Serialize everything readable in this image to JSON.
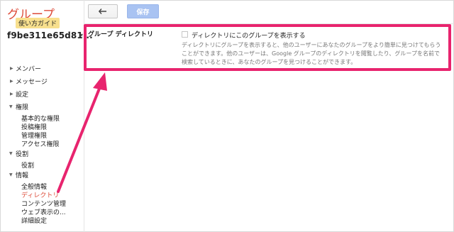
{
  "app": {
    "logo_title": "グループ",
    "logo_subtitle": "使い方ガイド",
    "group_id": "f9be311e65d81...",
    "group_caret": "▾"
  },
  "toolbar": {
    "back_label": "",
    "save_label": "保存"
  },
  "sidebar": {
    "sections": [
      {
        "label": "メンバー",
        "expanded": false
      },
      {
        "label": "メッセージ",
        "expanded": false
      },
      {
        "label": "設定",
        "expanded": false
      },
      {
        "label": "権限",
        "expanded": true,
        "items": [
          "基本的な権限",
          "投稿権限",
          "管理権限",
          "アクセス権限"
        ]
      },
      {
        "label": "役割",
        "expanded": true,
        "items": [
          "役割"
        ]
      },
      {
        "label": "情報",
        "expanded": true,
        "items": [
          "全般情報",
          "ディレクトリ",
          "コンテンツ管理",
          "ウェブ表示の...",
          "詳細設定"
        ]
      }
    ],
    "active_item": "ディレクトリ"
  },
  "main": {
    "setting_label": "グループ ディレクトリ",
    "checkbox_label": "ディレクトリにこのグループを表示する",
    "checkbox_checked": false,
    "description_lines": [
      "ディレクトリにグループを表示すると、他のユーザーにあなたのグループをより簡単に見つけてもらう",
      "ことができます。他のユーザーは、Google グループのディレクトリを閲覧したり、グループを名前で",
      "検索しているときに、あなたのグループを見つけることができます。"
    ]
  },
  "colors": {
    "brand_red": "#dd4b39",
    "annotation_pink": "#e8246e",
    "save_button": "#a9c3f2"
  }
}
